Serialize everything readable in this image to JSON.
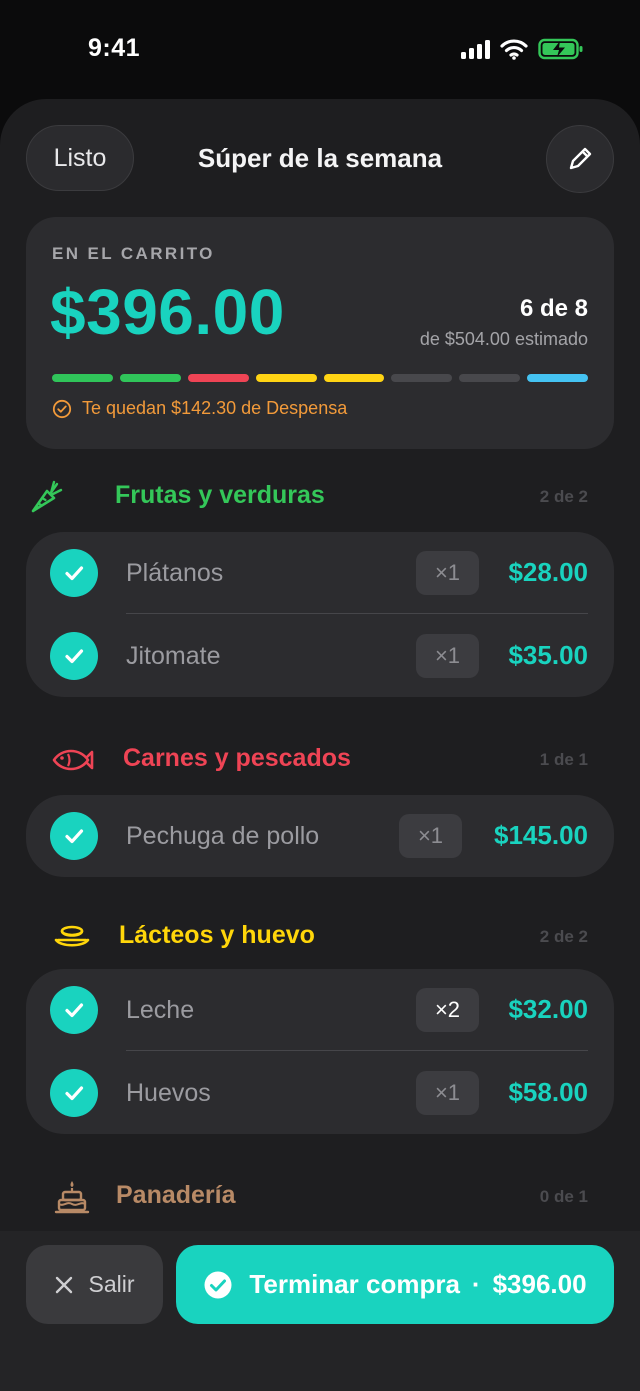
{
  "status_bar": {
    "time": "9:41"
  },
  "header": {
    "done_label": "Listo",
    "title": "Súper de la semana"
  },
  "summary": {
    "label": "EN EL CARRITO",
    "total": "$396.00",
    "count": "6 de 8",
    "estimate": "de $504.00 estimado",
    "progress_colors": [
      "#30c55a",
      "#30c55a",
      "#ef4455",
      "#ffd414",
      "#ffd414",
      "#48484c",
      "#48484c",
      "#45c3f2"
    ],
    "note": "Te quedan $142.30 de Despensa"
  },
  "sections": [
    {
      "title": "Frutas y verduras",
      "count": "2 de 2",
      "color": "#34c759",
      "icon": "carrot-icon",
      "items": [
        {
          "name": "Plátanos",
          "qty": "×1",
          "price": "$28.00",
          "checked": true
        },
        {
          "name": "Jitomate",
          "qty": "×1",
          "price": "$35.00",
          "checked": true
        }
      ]
    },
    {
      "title": "Carnes y pescados",
      "count": "1 de 1",
      "color": "#ef4455",
      "icon": "fish-icon",
      "items": [
        {
          "name": "Pechuga de pollo",
          "qty": "×1",
          "price": "$145.00",
          "checked": true
        }
      ]
    },
    {
      "title": "Lácteos y huevo",
      "count": "2 de 2",
      "color": "#ffd60a",
      "icon": "bowl-icon",
      "items": [
        {
          "name": "Leche",
          "qty": "×2",
          "price": "$32.00",
          "checked": true
        },
        {
          "name": "Huevos",
          "qty": "×1",
          "price": "$58.00",
          "checked": true
        }
      ]
    },
    {
      "title": "Panadería",
      "count": "0 de 1",
      "color": "#b88a66",
      "icon": "cake-icon",
      "items": []
    }
  ],
  "bottom": {
    "exit_label": "Salir",
    "finish_label": "Terminar compra",
    "finish_separator": "·",
    "finish_total": "$396.00"
  }
}
